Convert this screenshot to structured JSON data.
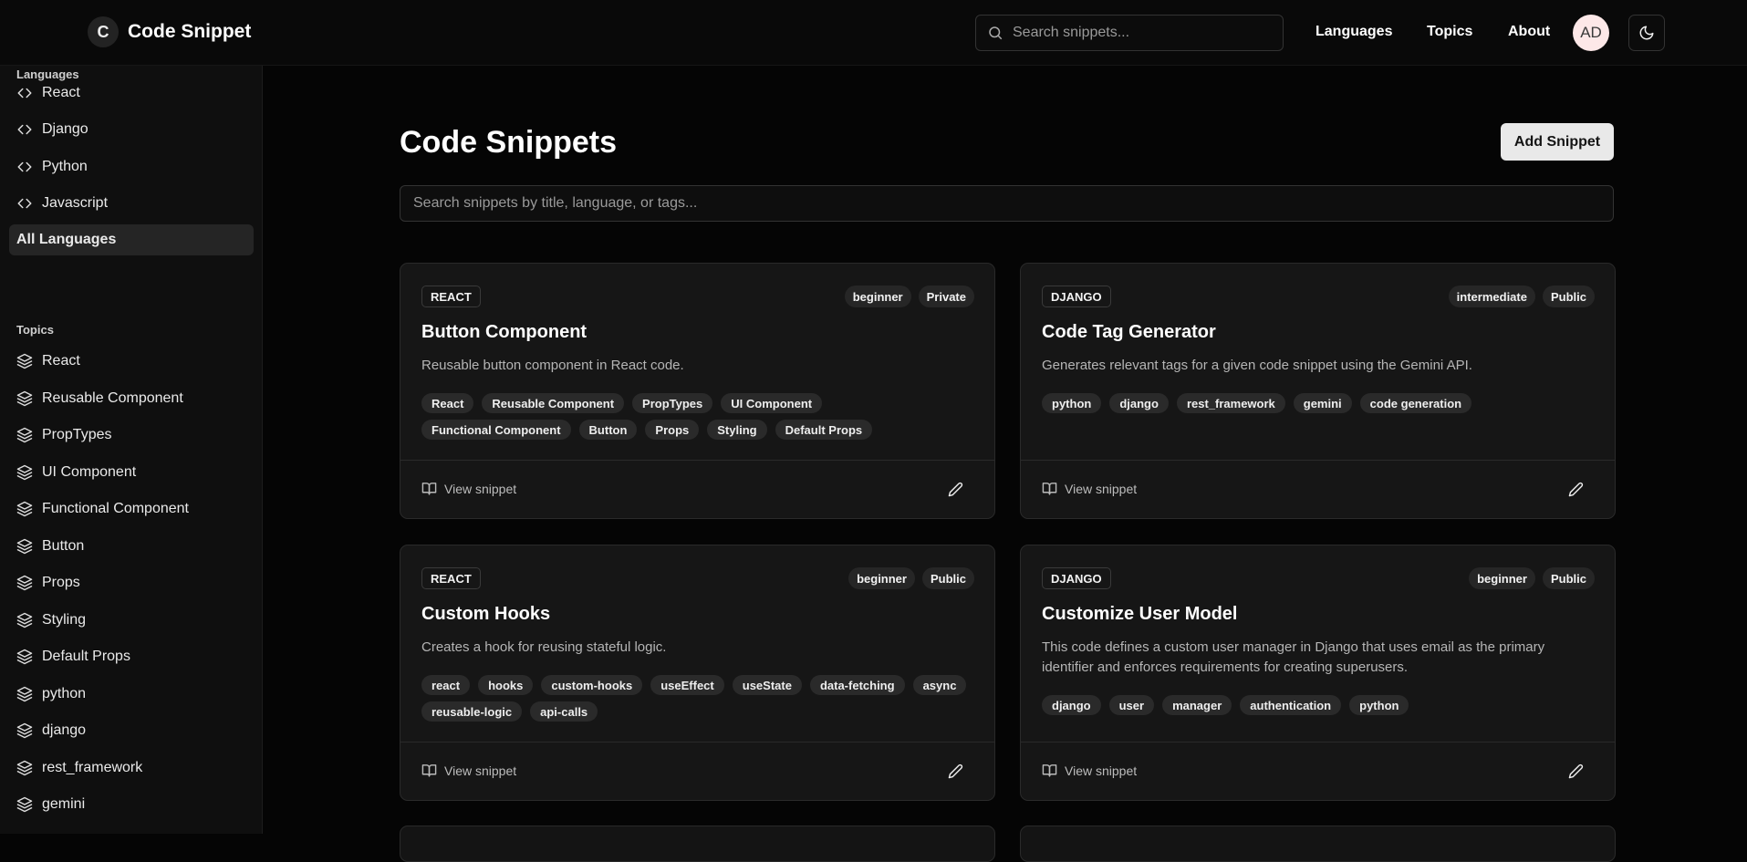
{
  "app": {
    "logo_letter": "C",
    "name": "Code Snippet"
  },
  "header": {
    "search_placeholder": "Search snippets...",
    "nav": [
      "Languages",
      "Topics",
      "About"
    ],
    "avatar_initials": "AD"
  },
  "sidebar": {
    "languages_heading": "Languages",
    "languages": [
      "React",
      "Django",
      "Python",
      "Javascript",
      "All Languages"
    ],
    "topics_heading": "Topics",
    "topics": [
      "React",
      "Reusable Component",
      "PropTypes",
      "UI Component",
      "Functional Component",
      "Button",
      "Props",
      "Styling",
      "Default Props",
      "python",
      "django",
      "rest_framework",
      "gemini"
    ]
  },
  "main": {
    "title": "Code Snippets",
    "add_button": "Add Snippet",
    "search_placeholder": "Search snippets by title, language, or tags...",
    "view_label": "View snippet",
    "cards": [
      {
        "language": "REACT",
        "level": "beginner",
        "visibility": "Private",
        "title": "Button Component",
        "description": "Reusable button component in React code.",
        "tags": [
          "React",
          "Reusable Component",
          "PropTypes",
          "UI Component",
          "Functional Component",
          "Button",
          "Props",
          "Styling",
          "Default Props"
        ]
      },
      {
        "language": "DJANGO",
        "level": "intermediate",
        "visibility": "Public",
        "title": "Code Tag Generator",
        "description": "Generates relevant tags for a given code snippet using the Gemini API.",
        "tags": [
          "python",
          "django",
          "rest_framework",
          "gemini",
          "code generation"
        ]
      },
      {
        "language": "REACT",
        "level": "beginner",
        "visibility": "Public",
        "title": "Custom Hooks",
        "description": "Creates a hook for reusing stateful logic.",
        "tags": [
          "react",
          "hooks",
          "custom-hooks",
          "useEffect",
          "useState",
          "data-fetching",
          "async",
          "reusable-logic",
          "api-calls"
        ]
      },
      {
        "language": "DJANGO",
        "level": "beginner",
        "visibility": "Public",
        "title": "Customize User Model",
        "description": "This code defines a custom user manager in Django that uses email as the primary identifier and enforces requirements for creating superusers.",
        "tags": [
          "django",
          "user",
          "manager",
          "authentication",
          "python"
        ]
      }
    ]
  }
}
